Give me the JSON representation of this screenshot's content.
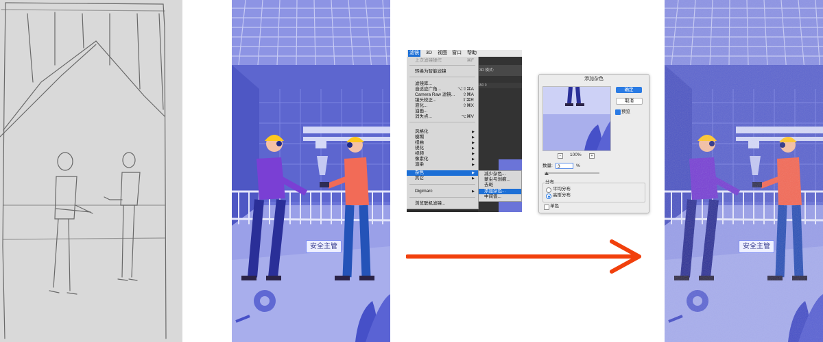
{
  "illustration": {
    "badge_label": "安全主管"
  },
  "ps_menu": {
    "menubar": [
      "滤镜",
      "3D",
      "视图",
      "窗口",
      "帮助"
    ],
    "items": [
      {
        "label": "上次滤镜操作",
        "shortcut": "⌘F",
        "disabled": true
      },
      {
        "label": "转换为智能滤镜",
        "shortcut": ""
      },
      {
        "label": "滤镜库...",
        "shortcut": ""
      },
      {
        "label": "自适应广角...",
        "shortcut": "⌥⇧⌘A"
      },
      {
        "label": "Camera Raw 滤镜...",
        "shortcut": "⇧⌘A"
      },
      {
        "label": "镜头校正...",
        "shortcut": "⇧⌘R"
      },
      {
        "label": "液化...",
        "shortcut": "⇧⌘X"
      },
      {
        "label": "油画...",
        "shortcut": ""
      },
      {
        "label": "消失点...",
        "shortcut": "⌥⌘V"
      },
      {
        "label": "风格化",
        "shortcut": "▶"
      },
      {
        "label": "模糊",
        "shortcut": "▶"
      },
      {
        "label": "扭曲",
        "shortcut": "▶"
      },
      {
        "label": "锐化",
        "shortcut": "▶"
      },
      {
        "label": "视频",
        "shortcut": "▶"
      },
      {
        "label": "像素化",
        "shortcut": "▶"
      },
      {
        "label": "渲染",
        "shortcut": "▶"
      },
      {
        "label": "杂色",
        "shortcut": "▶"
      },
      {
        "label": "其它",
        "shortcut": "▶"
      },
      {
        "label": "Digimarc",
        "shortcut": "▶"
      },
      {
        "label": "浏览联机滤镜...",
        "shortcut": ""
      }
    ],
    "submenu": [
      "减少杂色...",
      "蒙尘与划痕...",
      "去斑",
      "添加杂色...",
      "中间值..."
    ],
    "toolbar_text": "3D 模式:",
    "ruler_text": "150    0"
  },
  "dialog": {
    "title": "添加杂色",
    "ok_label": "确定",
    "cancel_label": "取消",
    "preview_label": "预览",
    "zoom_label": "100%",
    "amount_label": "数量:",
    "amount_value": "3",
    "amount_unit": "%",
    "distribution_label": "分布",
    "uniform_label": "平均分布",
    "gaussian_label": "高斯分布",
    "mono_label": "单色"
  },
  "colors": {
    "illustration_bg": "#6b74d8",
    "arrow": "#f1400c",
    "menu_highlight": "#1c6fd6",
    "dialog_ok": "#2a7be4"
  }
}
